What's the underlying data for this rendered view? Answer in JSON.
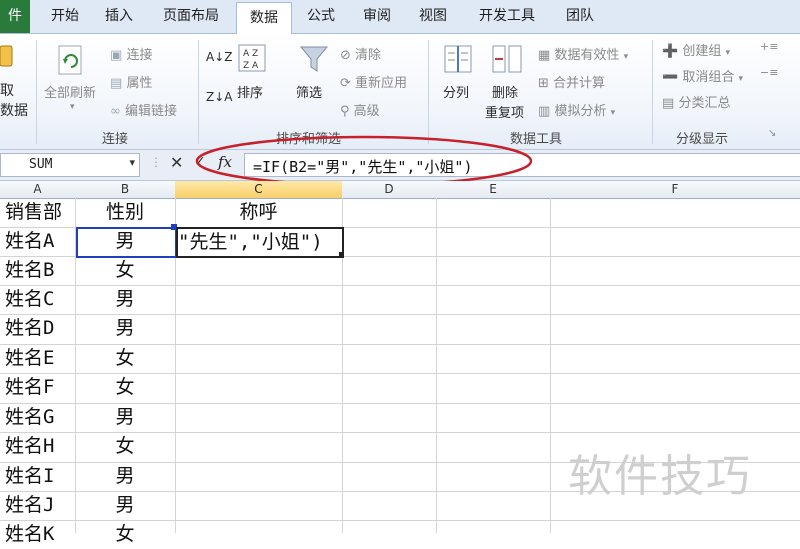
{
  "ribbon_tabs": {
    "file": "件",
    "home": "开始",
    "insert": "插入",
    "page_layout": "页面布局",
    "data": "数据",
    "formulas": "公式",
    "review": "审阅",
    "view": "视图",
    "developer": "开发工具",
    "team": "团队"
  },
  "ribbon": {
    "get_data_line1": "取",
    "get_data_line2": "数据",
    "refresh_all": "全部刷新",
    "connections": "连接",
    "properties": "属性",
    "edit_links": "编辑链接",
    "group_connections": "连接",
    "sort": "排序",
    "filter": "筛选",
    "clear": "清除",
    "reapply": "重新应用",
    "advanced": "高级",
    "group_sort_filter": "排序和筛选",
    "text_to_columns": "分列",
    "remove_dup_line1": "删除",
    "remove_dup_line2": "重复项",
    "data_validation": "数据有效性",
    "consolidate": "合并计算",
    "what_if": "模拟分析",
    "group_data_tools": "数据工具",
    "group": "创建组",
    "ungroup": "取消组合",
    "subtotal": "分类汇总",
    "group_outline": "分级显示"
  },
  "formula_bar": {
    "name_box": "SUM",
    "fx_label": "fx",
    "formula": "=IF(B2=\"男\",\"先生\",\"小姐\")"
  },
  "columns": [
    "A",
    "B",
    "C",
    "D",
    "E",
    "F"
  ],
  "headers": {
    "dept": "销售部",
    "gender": "性别",
    "title": "称呼"
  },
  "rows": [
    {
      "name": "姓名A",
      "gender": "男"
    },
    {
      "name": "姓名B",
      "gender": "女"
    },
    {
      "name": "姓名C",
      "gender": "男"
    },
    {
      "name": "姓名D",
      "gender": "男"
    },
    {
      "name": "姓名E",
      "gender": "女"
    },
    {
      "name": "姓名F",
      "gender": "女"
    },
    {
      "name": "姓名G",
      "gender": "男"
    },
    {
      "name": "姓名H",
      "gender": "女"
    },
    {
      "name": "姓名I",
      "gender": "男"
    },
    {
      "name": "姓名J",
      "gender": "男"
    },
    {
      "name": "姓名K",
      "gender": "女"
    }
  ],
  "editing_cell_text": "\"先生\",\"小姐\")",
  "watermark": "软件技巧",
  "colors": {
    "annotation_red": "#c8202a",
    "selection_blue": "#1f3fbf",
    "file_tab_green": "#2a7a3b"
  }
}
